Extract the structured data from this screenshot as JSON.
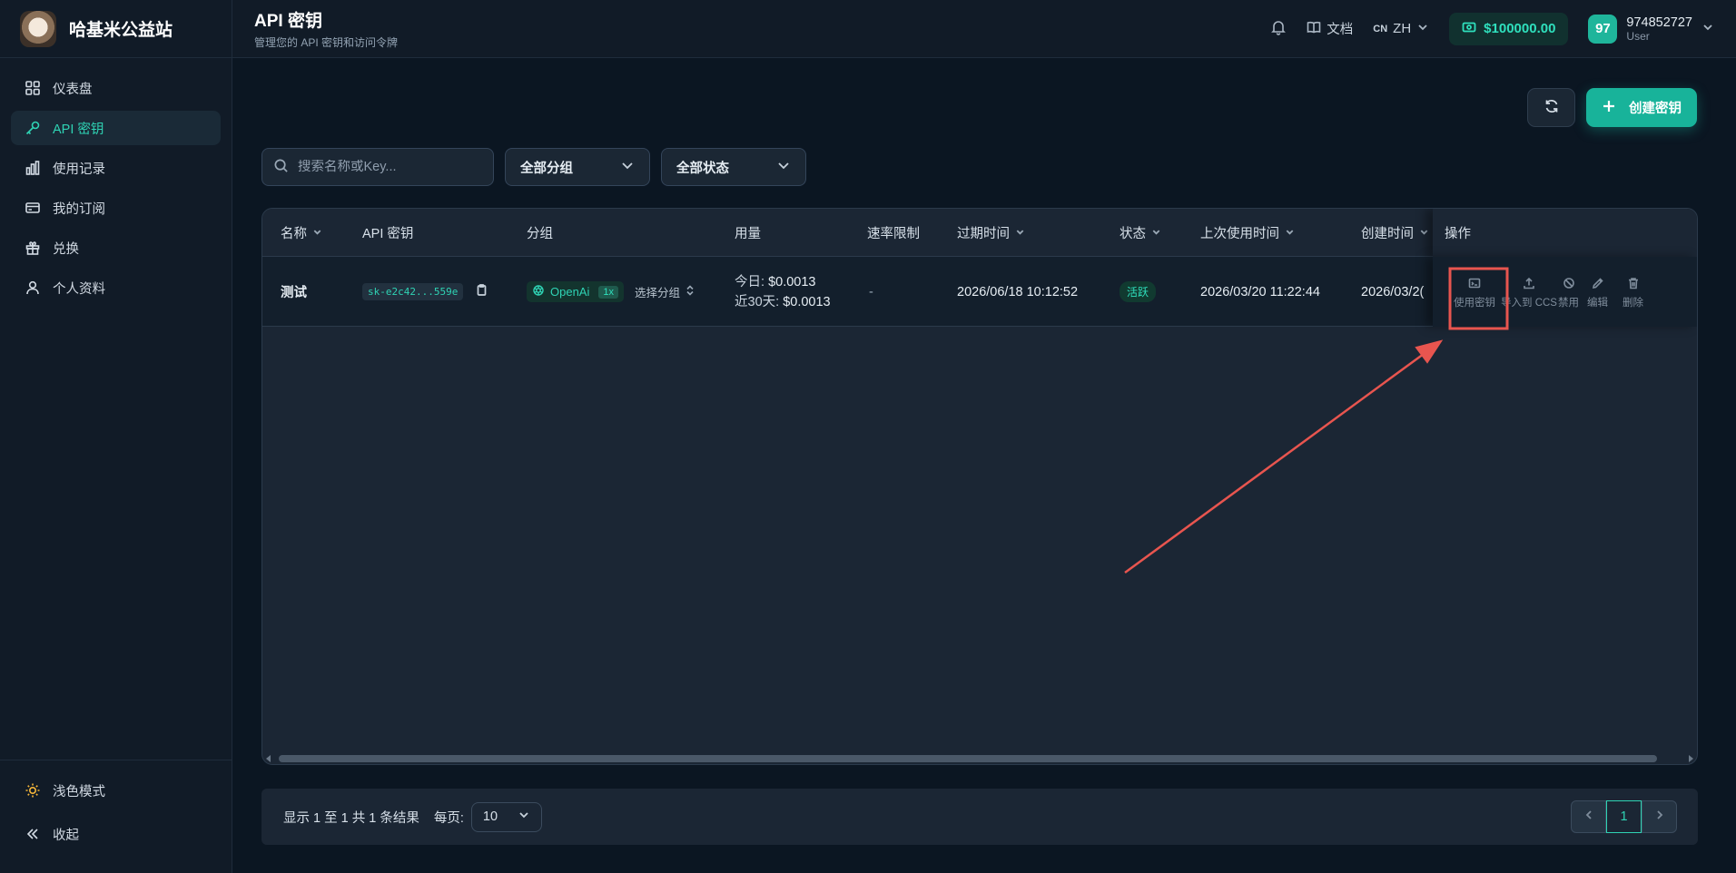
{
  "brand": {
    "name": "哈基米公益站"
  },
  "sidebar": {
    "items": [
      {
        "label": "仪表盘",
        "icon": "dashboard-icon",
        "active": false
      },
      {
        "label": "API 密钥",
        "icon": "key-icon",
        "active": true
      },
      {
        "label": "使用记录",
        "icon": "chart-icon",
        "active": false
      },
      {
        "label": "我的订阅",
        "icon": "credit-card-icon",
        "active": false
      },
      {
        "label": "兑换",
        "icon": "gift-icon",
        "active": false
      },
      {
        "label": "个人资料",
        "icon": "user-icon",
        "active": false
      }
    ],
    "theme_toggle": "浅色模式",
    "collapse": "收起"
  },
  "header": {
    "title": "API 密钥",
    "subtitle": "管理您的 API 密钥和访问令牌",
    "docs": "文档",
    "lang_code": "CN",
    "lang": "ZH",
    "balance": "$100000.00",
    "avatar_text": "97",
    "username": "974852727",
    "role": "User"
  },
  "toolbar": {
    "create_label": "创建密钥",
    "search_placeholder": "搜索名称或Key...",
    "group_filter": "全部分组",
    "status_filter": "全部状态"
  },
  "table": {
    "columns": [
      "名称",
      "API 密钥",
      "分组",
      "用量",
      "速率限制",
      "过期时间",
      "状态",
      "上次使用时间",
      "创建时间",
      "操作"
    ],
    "rows": [
      {
        "name": "测试",
        "key": "sk-e2c42...559e",
        "group": "OpenAi",
        "multiplier": "1x",
        "select_group": "选择分组",
        "usage_today_label": "今日:",
        "usage_today": "$0.0013",
        "usage_30d_label": "近30天:",
        "usage_30d": "$0.0013",
        "rate_limit": "-",
        "expires": "2026/06/18 10:12:52",
        "status": "活跃",
        "last_used": "2026/03/20 11:22:44",
        "created": "2026/03/2("
      }
    ],
    "actions": [
      "使用密钥",
      "导入到 CCS",
      "禁用",
      "编辑",
      "删除"
    ]
  },
  "pagination": {
    "summary": "显示 1 至 1 共 1 条结果",
    "per_page_label": "每页:",
    "per_page": "10",
    "current_page": "1"
  },
  "colors": {
    "accent": "#18b39a",
    "annotation": "#e8554f"
  }
}
